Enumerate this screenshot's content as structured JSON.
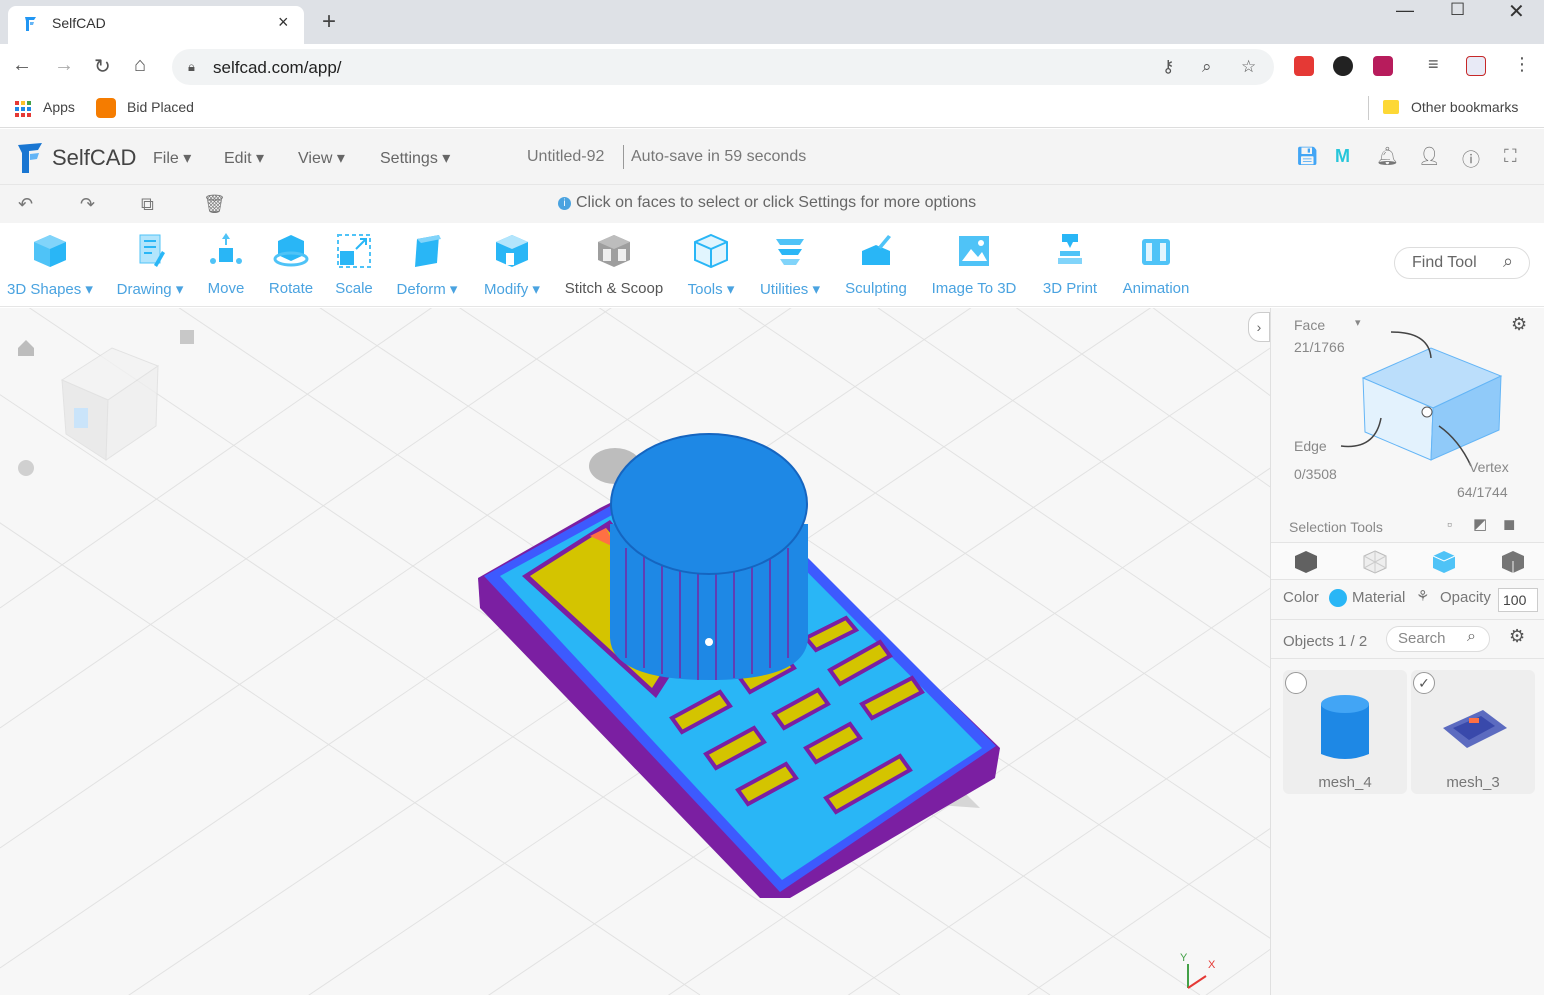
{
  "browser": {
    "tab_title": "SelfCAD",
    "new_tab": "+",
    "url": "selfcad.com/app/",
    "bookmarks": {
      "apps": "Apps",
      "bid_placed": "Bid Placed",
      "other": "Other bookmarks"
    }
  },
  "app": {
    "logo_text": "SelfCAD",
    "menus": {
      "file": "File",
      "edit": "Edit",
      "view": "View",
      "settings": "Settings"
    },
    "doc_title": "Untitled-92",
    "autosave": "Auto-save in 59 seconds",
    "hint": "Click on faces to select or click Settings for more options"
  },
  "toolbar": {
    "shapes": "3D Shapes",
    "drawing": "Drawing",
    "move": "Move",
    "rotate": "Rotate",
    "scale": "Scale",
    "deform": "Deform",
    "modify": "Modify",
    "stitch": "Stitch & Scoop",
    "tools": "Tools",
    "utilities": "Utilities",
    "sculpting": "Sculpting",
    "image3d": "Image To 3D",
    "print3d": "3D Print",
    "animation": "Animation",
    "find_tool": "Find Tool"
  },
  "panel": {
    "face_label": "Face",
    "face_count": "21/1766",
    "edge_label": "Edge",
    "edge_count": "0/3508",
    "vertex_label": "Vertex",
    "vertex_count": "64/1744",
    "selection_tools": "Selection Tools",
    "color": "Color",
    "material": "Material",
    "opacity": "Opacity",
    "opacity_value": "100",
    "objects": "Objects 1 / 2",
    "search_placeholder": "Search",
    "objects_list": [
      {
        "name": "mesh_4",
        "selected": false
      },
      {
        "name": "mesh_3",
        "selected": true
      }
    ]
  },
  "colors": {
    "accent": "#4aa3e0",
    "model_blue": "#1e88e5",
    "model_cyan": "#29b6f6",
    "model_magenta": "#9c27b0",
    "model_yellow": "#d4c400"
  }
}
